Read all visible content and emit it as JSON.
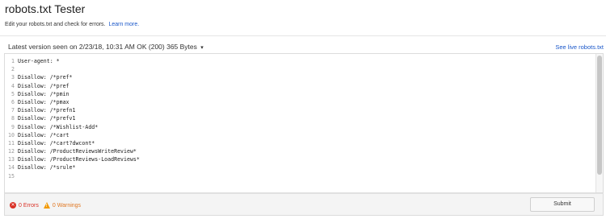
{
  "header": {
    "title": "robots.txt Tester",
    "description": "Edit your robots.txt and check for errors.",
    "learn_more": "Learn more."
  },
  "version": {
    "label": "Latest version seen on 2/23/18, 10:31 AM OK (200) 365 Bytes",
    "caret": "▾",
    "live_link": "See live robots.txt"
  },
  "editor": {
    "lines": [
      {
        "num": "1",
        "text": "User-agent: *"
      },
      {
        "num": "2",
        "text": ""
      },
      {
        "num": "3",
        "text": "Disallow: /*pref*"
      },
      {
        "num": "4",
        "text": "Disallow: /*pref"
      },
      {
        "num": "5",
        "text": "Disallow: /*pmin"
      },
      {
        "num": "6",
        "text": "Disallow: /*pmax"
      },
      {
        "num": "7",
        "text": "Disallow: /*prefn1"
      },
      {
        "num": "8",
        "text": "Disallow: /*prefv1"
      },
      {
        "num": "9",
        "text": "Disallow: /*Wishlist-Add*"
      },
      {
        "num": "10",
        "text": "Disallow: /*cart"
      },
      {
        "num": "11",
        "text": "Disallow: /*cart?dwcont*"
      },
      {
        "num": "12",
        "text": "Disallow: /ProductReviewsWriteReview*"
      },
      {
        "num": "13",
        "text": "Disallow: /ProductReviews-LoadReviews*"
      },
      {
        "num": "14",
        "text": "Disallow: /*srule*"
      },
      {
        "num": "15",
        "text": ""
      }
    ]
  },
  "footer": {
    "errors": "0 Errors",
    "warnings": "0 Warnings",
    "submit": "Submit",
    "error_icon": "✕",
    "warning_icon": "!"
  },
  "colors": {
    "link": "#1a57c9",
    "error": "#d93025",
    "warning": "#f29900"
  }
}
